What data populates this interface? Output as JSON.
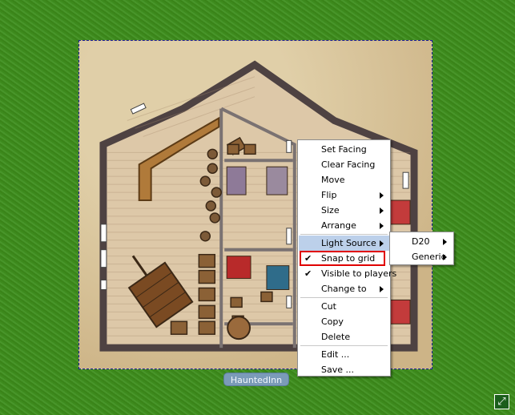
{
  "map": {
    "token_name": "HauntedInn"
  },
  "context_menu": {
    "items": [
      {
        "label": "Set Facing",
        "submenu": false,
        "checked": false
      },
      {
        "label": "Clear Facing",
        "submenu": false,
        "checked": false
      },
      {
        "label": "Move",
        "submenu": false,
        "checked": false
      },
      {
        "label": "Flip",
        "submenu": true,
        "checked": false
      },
      {
        "label": "Size",
        "submenu": true,
        "checked": false
      },
      {
        "label": "Arrange",
        "submenu": true,
        "checked": false
      },
      {
        "label": "Light Source",
        "submenu": true,
        "checked": false
      },
      {
        "label": "Snap to grid",
        "submenu": false,
        "checked": true
      },
      {
        "label": "Visible to players",
        "submenu": false,
        "checked": true
      },
      {
        "label": "Change to",
        "submenu": true,
        "checked": false
      },
      {
        "label": "Cut",
        "submenu": false,
        "checked": false
      },
      {
        "label": "Copy",
        "submenu": false,
        "checked": false
      },
      {
        "label": "Delete",
        "submenu": false,
        "checked": false
      },
      {
        "label": "Edit ...",
        "submenu": false,
        "checked": false
      },
      {
        "label": "Save ...",
        "submenu": false,
        "checked": false
      }
    ],
    "check_mark": "✔"
  },
  "light_source_submenu": {
    "items": [
      {
        "label": "D20",
        "submenu": true
      },
      {
        "label": "Generic",
        "submenu": true
      }
    ]
  },
  "colors": {
    "menu_highlight": "#bcd0ea",
    "focus_outline": "#e00000",
    "selection_border": "#1a1a9a",
    "label_background": "#7b9bb8"
  },
  "icons": {
    "resize_handle": "resize-icon"
  }
}
